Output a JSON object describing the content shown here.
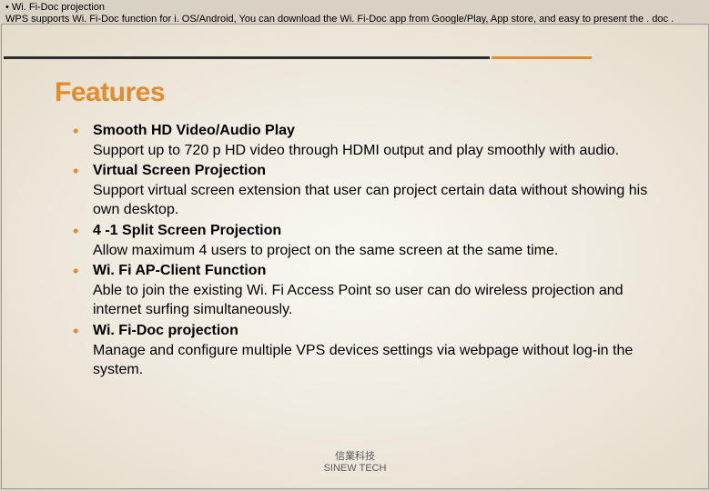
{
  "top": {
    "line1": " • Wi. Fi-Doc projection",
    "line2": " WPS supports Wi. Fi-Doc function for i. OS/Android, You can download the Wi. Fi-Doc app from Google/Play, App store, and easy to present the . doc ."
  },
  "slide": {
    "title": "Features",
    "items": [
      {
        "head": "Smooth HD Video/Audio Play",
        "body": "Support up to 720 p HD video through HDMI output and play smoothly with audio."
      },
      {
        "head": "Virtual Screen Projection",
        "body": "Support virtual screen extension that user can project certain data without showing his own desktop."
      },
      {
        "head": "4 -1 Split Screen Projection",
        "body": "Allow maximum 4 users to project on the same screen at the same time."
      },
      {
        "head": "Wi. Fi AP-Client Function",
        "body": " Able to join the existing Wi. Fi Access Point so user can do wireless projection and internet surfing simultaneously."
      },
      {
        "head": "Wi. Fi-Doc projection",
        "body": "Manage and configure multiple VPS devices settings via webpage without log-in the system."
      }
    ],
    "footer": {
      "line1": "信業科技",
      "line2": "SINEW TECH"
    }
  }
}
